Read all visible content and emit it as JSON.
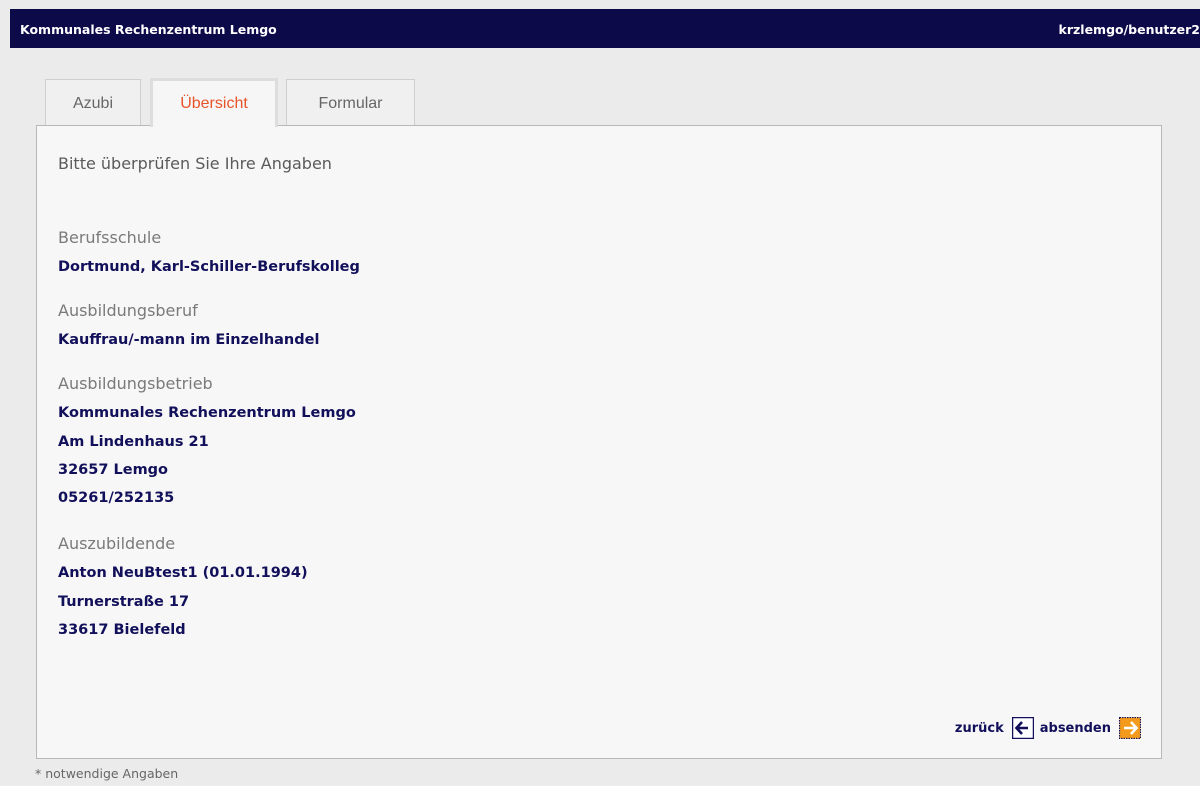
{
  "header": {
    "app_title": "Kommunales Rechenzentrum Lemgo",
    "user_path": "krzlemgo/benutzer2"
  },
  "tabs": [
    {
      "label": "Azubi",
      "active": false
    },
    {
      "label": "Übersicht",
      "active": true
    },
    {
      "label": "Formular",
      "active": false
    }
  ],
  "main": {
    "intro": "Bitte überprüfen Sie Ihre Angaben",
    "berufsschule": {
      "label": "Berufsschule",
      "value": "Dortmund, Karl-Schiller-Berufskolleg"
    },
    "ausbildungsberuf": {
      "label": "Ausbildungsberuf",
      "value": "Kauffrau/-mann im Einzelhandel"
    },
    "ausbildungsbetrieb": {
      "label": "Ausbildungsbetrieb",
      "name": "Kommunales Rechenzentrum Lemgo",
      "street": "Am Lindenhaus 21",
      "city": "32657 Lemgo",
      "phone": "05261/252135"
    },
    "auszubildende": {
      "label": "Auszubildende",
      "name": "Anton NeuBtest1 (01.01.1994)",
      "street": "Turnerstraße 17",
      "city": "33617 Bielefeld"
    }
  },
  "actions": {
    "back_label": "zurück",
    "back_icon": "arrow-left-icon",
    "submit_label": "absenden",
    "submit_icon": "arrow-right-icon"
  },
  "footnote": "* notwendige Angaben",
  "colors": {
    "header_bg": "#0d0a4a",
    "value_text": "#12105a",
    "active_tab_text": "#e8542a",
    "submit_icon_bg": "#f39a1c"
  }
}
